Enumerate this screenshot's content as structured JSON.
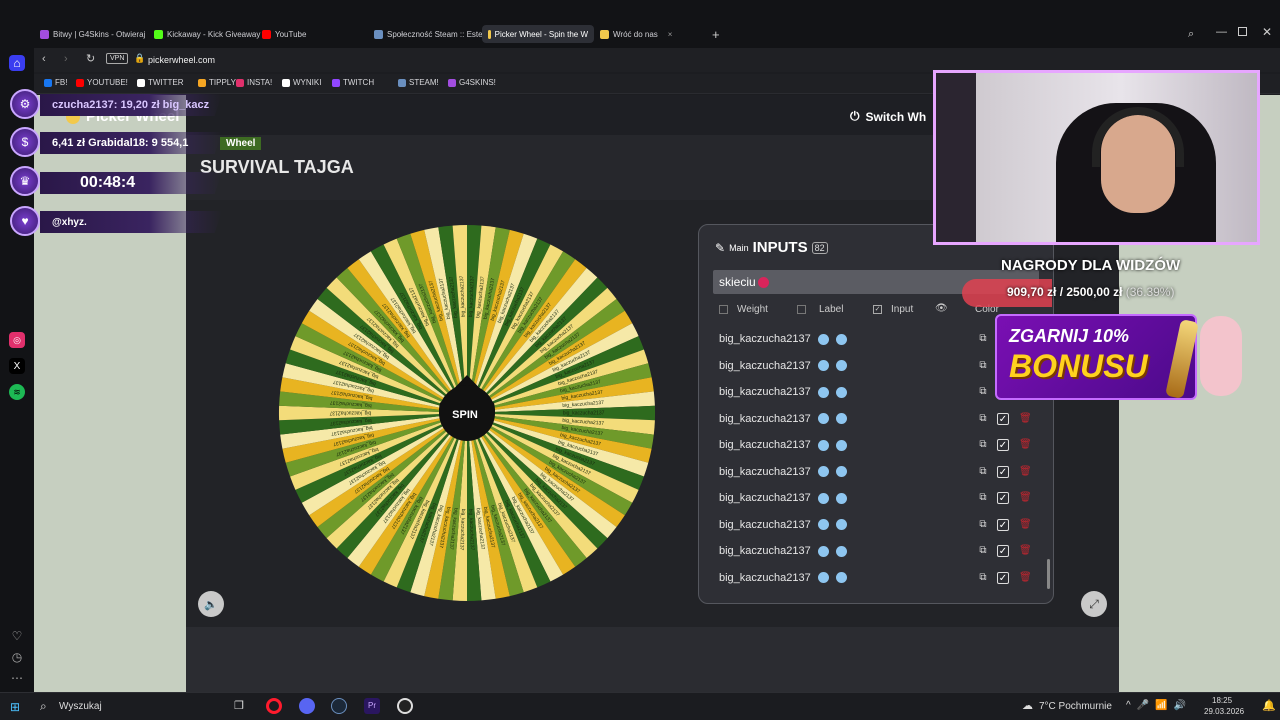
{
  "browser": {
    "tabs": [
      {
        "label": "Bitwy | G4Skins - Otwieraj",
        "color": "#a24de0"
      },
      {
        "label": "Kickaway - Kick Giveaway",
        "color": "#53fc18"
      },
      {
        "label": "YouTube",
        "color": "#ff0000"
      },
      {
        "label": "Społeczność Steam :: Este",
        "color": "#6a8fbf"
      },
      {
        "label": "Picker Wheel - Spin the W",
        "color": "#f2c94c"
      },
      {
        "label": "Wróć do nas",
        "color": "#f2c94c"
      }
    ],
    "url": "pickerwheel.com",
    "vpn": "VPN",
    "bookmarks": [
      {
        "label": "FB!",
        "color": "#1877f2"
      },
      {
        "label": "YOUTUBE!",
        "color": "#ff0000"
      },
      {
        "label": "TWITTER",
        "color": "#ffffff"
      },
      {
        "label": "TIPPLY",
        "color": "#f5a623"
      },
      {
        "label": "INSTA!",
        "color": "#e1306c"
      },
      {
        "label": "WYNIKI",
        "color": "#ffffff"
      },
      {
        "label": "TWITCH",
        "color": "#9146ff"
      },
      {
        "label": "STEAM!",
        "color": "#6a8fbf"
      },
      {
        "label": "G4SKINS!",
        "color": "#a24de0"
      }
    ]
  },
  "picker": {
    "brand": "Picker Wheel",
    "switch_label": "Switch Wh",
    "wheel_tab": "Wheel",
    "title": "SURVIVAL TAJGA",
    "spin_label": "SPIN",
    "wheel_colors": [
      "#2e6b1e",
      "#f3dc7a",
      "#6f9a2a",
      "#e8b421",
      "#f6e9a8"
    ],
    "inputs": {
      "mode": "Main",
      "title": "INPUTS",
      "count": "82",
      "entry_value": "skieciu",
      "columns": {
        "weight": "Weight",
        "label": "Label",
        "input": "Input",
        "color": "Color"
      },
      "rows": [
        "big_kaczucha2137",
        "big_kaczucha2137",
        "big_kaczucha2137",
        "big_kaczucha2137",
        "big_kaczucha2137",
        "big_kaczucha2137",
        "big_kaczucha2137",
        "big_kaczucha2137",
        "big_kaczucha2137",
        "big_kaczucha2137"
      ]
    }
  },
  "stream": {
    "donation_line": "czucha2137: 19,20 zł big_kacz",
    "goal_line": "6,41 zł Grabidal18: 9 554,1",
    "timer": "00:48:4",
    "follower": "@xhyz.",
    "rewards_title": "NAGRODY DLA WIDZÓW",
    "rewards_progress": "909,70 zł / 2500,00 zł",
    "rewards_percent": "(36.39%)",
    "bonus_top": "ZGARNIJ 10%",
    "bonus_main": "BONUSU"
  },
  "taskbar": {
    "search_placeholder": "Wyszukaj",
    "weather": "7°C Pochmurnie",
    "time": "18:25",
    "date": "29.03.2026"
  }
}
